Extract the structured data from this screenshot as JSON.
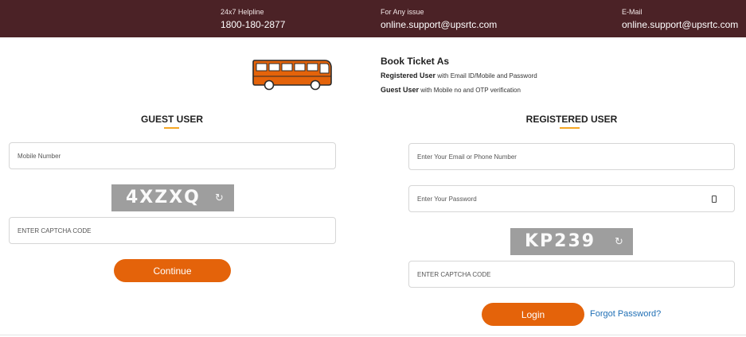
{
  "topbar": {
    "helpline_label": "24x7 Helpline",
    "helpline_value": "1800-180-2877",
    "issue_label": "For Any issue",
    "issue_value": "online.support@upsrtc.com",
    "email_label": "E-Mail",
    "email_value": "online.support@upsrtc.com"
  },
  "book": {
    "title": "Book Ticket As",
    "registered_bold": "Registered User",
    "registered_rest": "with Email ID/Mobile and Password",
    "guest_bold": "Guest User",
    "guest_rest": "with Mobile no and OTP verification"
  },
  "guest": {
    "title": "GUEST USER",
    "mobile_placeholder": "Mobile Number",
    "captcha_text": "4XZXQ",
    "captcha_placeholder": "ENTER CAPTCHA CODE",
    "continue_label": "Continue"
  },
  "registered": {
    "title": "REGISTERED USER",
    "email_placeholder": "Enter Your Email or Phone Number",
    "password_placeholder": "Enter Your Password",
    "captcha_text": "KP239",
    "captcha_placeholder": "ENTER CAPTCHA CODE",
    "login_label": "Login",
    "forgot_label": "Forgot Password?"
  },
  "icons": {
    "refresh": "refresh-icon",
    "eye": "eye-icon",
    "bus": "bus-icon"
  },
  "colors": {
    "topbar": "#4b2226",
    "accent": "#e4630a",
    "underline": "#f5a623",
    "link": "#1f6fb5"
  }
}
